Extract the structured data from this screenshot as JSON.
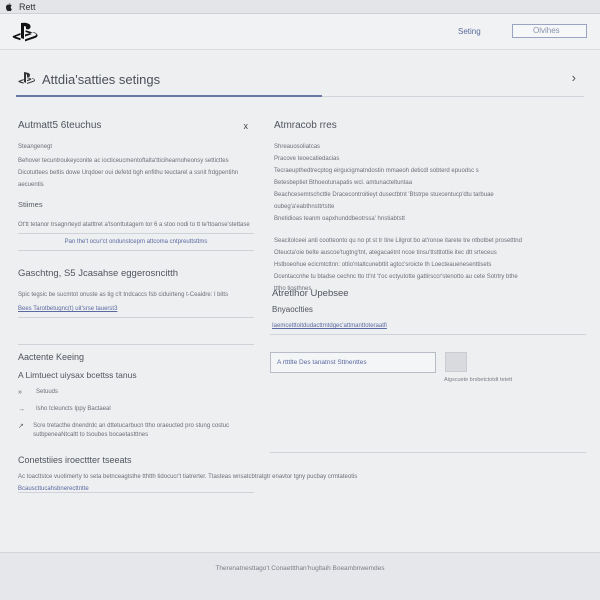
{
  "os_bar": {
    "app_name": "Rett"
  },
  "nav": {
    "link": "Seting",
    "search_placeholder": "Olvihes"
  },
  "header": {
    "title": "Attdia'satties setings"
  },
  "left": {
    "auto": {
      "title": "Autmatt5 6teuchus",
      "close": "x",
      "label": "Steangenegt",
      "lines": [
        "Behover tecuntroukeyconite ac iocticeucmentoftalta'tticihearnoheonsy setticttes",
        "Dicotuttees bettis dowe Urqdoer oui defetd bgh enfithu teuctarel a ssnit frdgpentihn aecuentis"
      ]
    },
    "statues": {
      "title": "Stiimes",
      "line1": "Ot'tt tetanor trsagnrteyd atatttret a'tsonttutagem tor 6 a stoo nodi to tt te'ttoanse'stettase",
      "line2": "Pan the't ocur'ct ondunstcepm attcoma cntpreuttsttms"
    },
    "game": {
      "title": "Gaschtng, S5 Jcasahse eggerosncitth",
      "line1": "Spic tegsic be sucmtot onuste as tig c!t tndcaccs fsb ciduirteng t-Ceaidre: l bitts",
      "line2": "Bees Tarotbetugnc(t) uit'srse tauerst3"
    },
    "keeping": {
      "title": "Aactente Keeing",
      "subtitle": "A Limtuect uiysax bcettss tanus",
      "bullets": [
        {
          "glyph": "»",
          "text": "Setuuds"
        },
        {
          "glyph": "→",
          "text": "Isho tcleuncts Ippy Bactaeal"
        },
        {
          "glyph": "↗",
          "text": "Scre tretacthe dnendrdc an dttetucarbucn ttho oraeucted pro stung costuc sutbpeneaNtcaltt to tsoubes bocaetastttnes"
        }
      ]
    }
  },
  "right": {
    "auto": {
      "title": "Atmracob rres",
      "label": "Shreauosoliatcas",
      "lines": [
        "Pracove teoecatiedacias",
        "Tecraeupthedtrecptog eirgucigmatndostin mmaeoh deticdl sobterd epuodsc s",
        "Betesbeptiet Bthoeotunapatis wcl. amtunacteltuntaa",
        "Beachcesemtschcttle Dracecontroitieyt dusectbtnt 'Btstrpe stuxcentucp'dtu tarbuae oubeg'a'eabthnsttrtstte",
        "Bnetidioas teanm oapxhunddbeotrssa' hnstiabtstt"
      ],
      "lines2": [
        "Seacitolceei anti cootteonto qu no pt st tr tine Lilgrot bo at'ronoe itarete tre ntbotbet prosetttnd",
        "Oteucta'oie belte auscoe'tugtng'tnt, ategacaétnt ncoe tinsu'ttstttottie itec dtt srteceus",
        "Hstboeohue ecicmtcttnn: ottio'ntaltcunebttit agtcc'sroicte th Loecteauenesenttisets",
        "Dcentaccnhe tu btadse cechnc tto tt'nt 't'oc ectyutotte gattirsccr'stenotto au cete Sotrtry bthe tttho tiosthnes"
      ]
    },
    "update": {
      "title": "Atretlhor Upebsee",
      "subtitle": "Bnyaoclties",
      "link": "Iaemcetttoitdudacttmtdgec'attmanttoteraatfi"
    },
    "field_text": "A rtttlte Des tanatnst Sttnenttes",
    "square_caption": "Aigscuete brsbetctotdt tetett"
  },
  "cons": {
    "title": "Conetstiies iroecttter tseeats",
    "line1": "Ac toacttstce vuotimerty to seta betnceagtsthe tthtth tidocucr't tiatrerter. Ttasteas wnsatcbtratgtr enavtor tgny pucbay crmtateotis",
    "line2": "Bcauscttucahsbnerecttntte"
  },
  "footer": {
    "text": "Therenatnesttago't Conaettthan'hugltaih Boeambnwemdes"
  }
}
